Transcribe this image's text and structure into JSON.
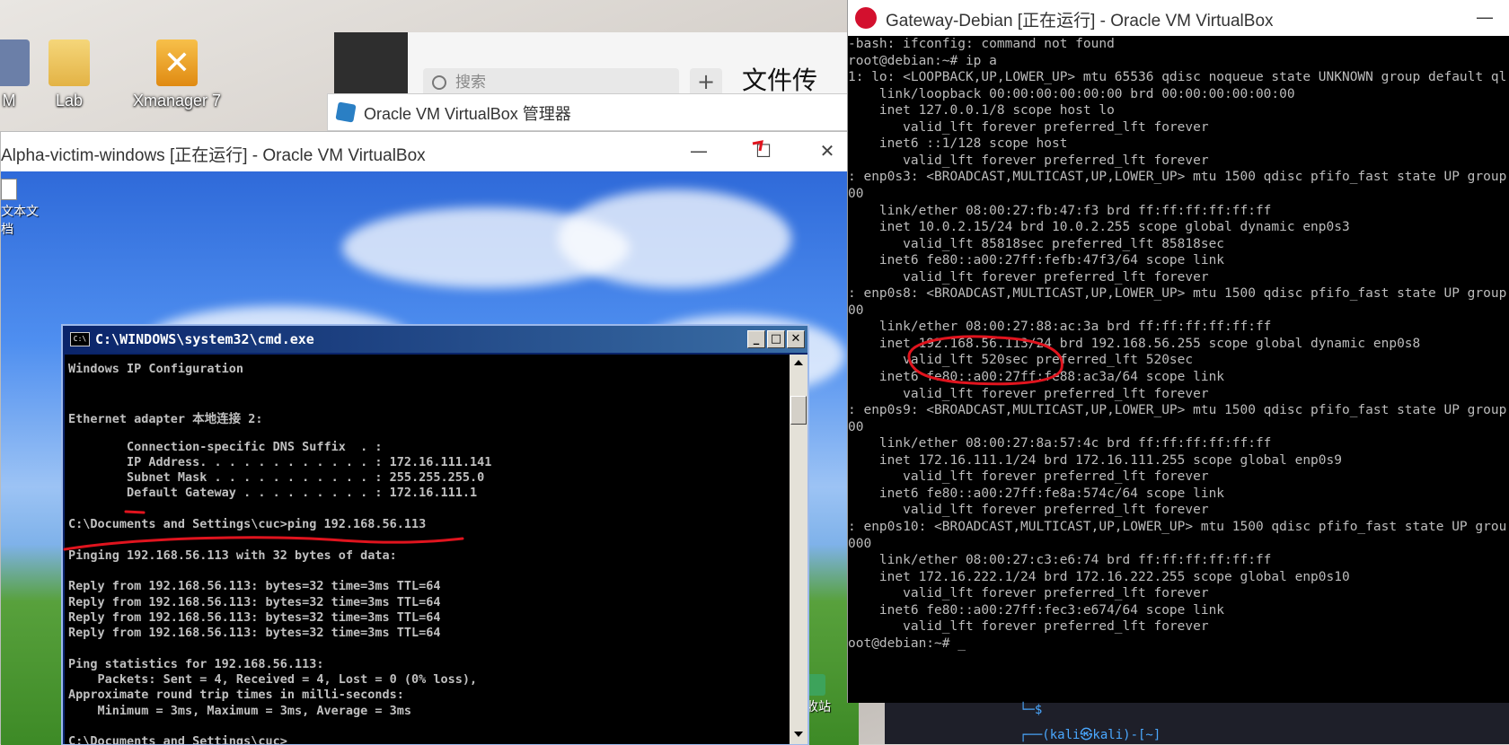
{
  "host_desktop": {
    "icons": [
      {
        "label": "M"
      },
      {
        "label": "Lab"
      },
      {
        "label": "Xmanager 7"
      }
    ]
  },
  "chat_app": {
    "search_placeholder": "搜索",
    "add_label": "+",
    "title_partial": "文件传"
  },
  "vbox_manager": {
    "title": "Oracle VM VirtualBox 管理器"
  },
  "alpha_window": {
    "title": "Alpha-victim-windows [正在运行] - Oracle VM VirtualBox",
    "desktop": {
      "doc_icon_label": "文本文档",
      "recycle_label": "收站"
    },
    "cmd": {
      "title": "C:\\WINDOWS\\system32\\cmd.exe",
      "icon_text": "C:\\",
      "lines": [
        "Windows IP Configuration",
        "",
        "",
        "Ethernet adapter 本地连接 2:",
        "",
        "        Connection-specific DNS Suffix  . :",
        "        IP Address. . . . . . . . . . . . : 172.16.111.141",
        "        Subnet Mask . . . . . . . . . . . : 255.255.255.0",
        "        Default Gateway . . . . . . . . . : 172.16.111.1",
        "",
        "C:\\Documents and Settings\\cuc>ping 192.168.56.113",
        "",
        "Pinging 192.168.56.113 with 32 bytes of data:",
        "",
        "Reply from 192.168.56.113: bytes=32 time=3ms TTL=64",
        "Reply from 192.168.56.113: bytes=32 time=3ms TTL=64",
        "Reply from 192.168.56.113: bytes=32 time=3ms TTL=64",
        "Reply from 192.168.56.113: bytes=32 time=3ms TTL=64",
        "",
        "Ping statistics for 192.168.56.113:",
        "    Packets: Sent = 4, Received = 4, Lost = 0 (0% loss),",
        "Approximate round trip times in milli-seconds:",
        "    Minimum = 3ms, Maximum = 3ms, Average = 3ms",
        "",
        "C:\\Documents and Settings\\cuc>"
      ]
    }
  },
  "debian_window": {
    "title": "Gateway-Debian [正在运行] - Oracle VM VirtualBox",
    "lines": [
      "-bash: ifconfig: command not found",
      "root@debian:~# ip a",
      "1: lo: <LOOPBACK,UP,LOWER_UP> mtu 65536 qdisc noqueue state UNKNOWN group default ql",
      "    link/loopback 00:00:00:00:00:00 brd 00:00:00:00:00:00",
      "    inet 127.0.0.1/8 scope host lo",
      "       valid_lft forever preferred_lft forever",
      "    inet6 ::1/128 scope host",
      "       valid_lft forever preferred_lft forever",
      ": enp0s3: <BROADCAST,MULTICAST,UP,LOWER_UP> mtu 1500 qdisc pfifo_fast state UP group",
      "00",
      "    link/ether 08:00:27:fb:47:f3 brd ff:ff:ff:ff:ff:ff",
      "    inet 10.0.2.15/24 brd 10.0.2.255 scope global dynamic enp0s3",
      "       valid_lft 85818sec preferred_lft 85818sec",
      "    inet6 fe80::a00:27ff:fefb:47f3/64 scope link",
      "       valid_lft forever preferred_lft forever",
      ": enp0s8: <BROADCAST,MULTICAST,UP,LOWER_UP> mtu 1500 qdisc pfifo_fast state UP group",
      "00",
      "    link/ether 08:00:27:88:ac:3a brd ff:ff:ff:ff:ff:ff",
      "    inet 192.168.56.113/24 brd 192.168.56.255 scope global dynamic enp0s8",
      "       valid_lft 520sec preferred_lft 520sec",
      "    inet6 fe80::a00:27ff:fe88:ac3a/64 scope link",
      "       valid_lft forever preferred_lft forever",
      ": enp0s9: <BROADCAST,MULTICAST,UP,LOWER_UP> mtu 1500 qdisc pfifo_fast state UP group",
      "00",
      "    link/ether 08:00:27:8a:57:4c brd ff:ff:ff:ff:ff:ff",
      "    inet 172.16.111.1/24 brd 172.16.111.255 scope global enp0s9",
      "       valid_lft forever preferred_lft forever",
      "    inet6 fe80::a00:27ff:fe8a:574c/64 scope link",
      "       valid_lft forever preferred_lft forever",
      ": enp0s10: <BROADCAST,MULTICAST,UP,LOWER_UP> mtu 1500 qdisc pfifo_fast state UP grou",
      "000",
      "    link/ether 08:00:27:c3:e6:74 brd ff:ff:ff:ff:ff:ff",
      "    inet 172.16.222.1/24 brd 172.16.222.255 scope global enp0s10",
      "       valid_lft forever preferred_lft forever",
      "    inet6 fe80::a00:27ff:fec3:e674/64 scope link",
      "       valid_lft forever preferred_lft forever",
      "oot@debian:~# _"
    ]
  },
  "kali_strip": {
    "line1": "└─$",
    "line2": "┌──(kali㉿kali)-[~]"
  },
  "colors": {
    "annotation_red": "#e0141e",
    "cmd_text": "#c0c0c0",
    "terminal_text": "#bcbcbc"
  }
}
